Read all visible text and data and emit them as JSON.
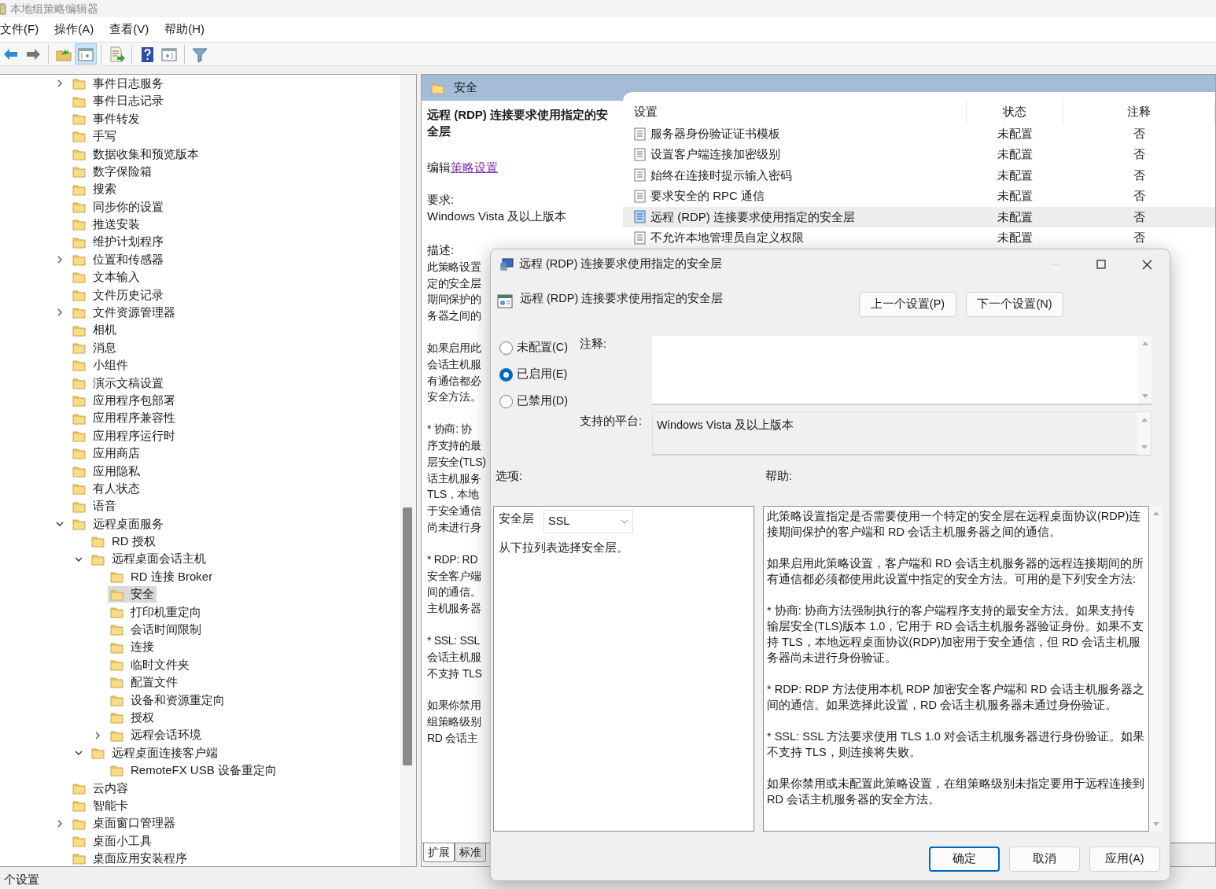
{
  "window": {
    "title": "本地组策略编辑器"
  },
  "menu": [
    {
      "label": "文件(F)"
    },
    {
      "label": "操作(A)"
    },
    {
      "label": "查看(V)"
    },
    {
      "label": "帮助(H)"
    }
  ],
  "toolbar": [
    {
      "kind": "back",
      "selected": false
    },
    {
      "kind": "forward",
      "selected": false
    },
    {
      "kind": "up",
      "selected": false
    },
    {
      "kind": "tree",
      "selected": true
    },
    {
      "kind": "export",
      "selected": false
    },
    {
      "kind": "help",
      "selected": false
    },
    {
      "kind": "pane",
      "selected": false
    },
    {
      "kind": "filter",
      "selected": false
    }
  ],
  "tree": [
    {
      "label": "事件日志服务",
      "expanded": false,
      "selected": false
    },
    {
      "label": "事件日志记录",
      "selected": false
    },
    {
      "label": "事件转发",
      "selected": false
    },
    {
      "label": "手写",
      "selected": false
    },
    {
      "label": "数据收集和预览版本",
      "selected": false
    },
    {
      "label": "数字保险箱",
      "selected": false
    },
    {
      "label": "搜索",
      "selected": false
    },
    {
      "label": "同步你的设置",
      "selected": false
    },
    {
      "label": "推送安装",
      "selected": false
    },
    {
      "label": "维护计划程序",
      "selected": false
    },
    {
      "label": "位置和传感器",
      "expanded": false,
      "selected": false
    },
    {
      "label": "文本输入",
      "selected": false
    },
    {
      "label": "文件历史记录",
      "selected": false
    },
    {
      "label": "文件资源管理器",
      "expanded": false,
      "selected": false
    },
    {
      "label": "相机",
      "selected": false
    },
    {
      "label": "消息",
      "selected": false
    },
    {
      "label": "小组件",
      "selected": false
    },
    {
      "label": "演示文稿设置",
      "selected": false
    },
    {
      "label": "应用程序包部署",
      "selected": false
    },
    {
      "label": "应用程序兼容性",
      "selected": false
    },
    {
      "label": "应用程序运行时",
      "selected": false
    },
    {
      "label": "应用商店",
      "selected": false
    },
    {
      "label": "应用隐私",
      "selected": false
    },
    {
      "label": "有人状态",
      "selected": false
    },
    {
      "label": "语音",
      "selected": false
    },
    {
      "label": "远程桌面服务",
      "expanded": true,
      "selected": false,
      "children": [
        {
          "label": "RD 授权",
          "selected": false
        },
        {
          "label": "远程桌面会话主机",
          "expanded": true,
          "selected": false,
          "children": [
            {
              "label": "RD 连接 Broker",
              "selected": false
            },
            {
              "label": "安全",
              "selected": true
            },
            {
              "label": "打印机重定向",
              "selected": false
            },
            {
              "label": "会话时间限制",
              "selected": false
            },
            {
              "label": "连接",
              "selected": false
            },
            {
              "label": "临时文件夹",
              "selected": false
            },
            {
              "label": "配置文件",
              "selected": false
            },
            {
              "label": "设备和资源重定向",
              "selected": false
            },
            {
              "label": "授权",
              "selected": false
            },
            {
              "label": "远程会话环境",
              "expanded": false,
              "selected": false
            }
          ]
        },
        {
          "label": "远程桌面连接客户端",
          "expanded": true,
          "selected": false,
          "children": [
            {
              "label": "RemoteFX USB 设备重定向",
              "selected": false
            }
          ]
        }
      ]
    },
    {
      "label": "云内容",
      "selected": false
    },
    {
      "label": "智能卡",
      "selected": false
    },
    {
      "label": "桌面窗口管理器",
      "expanded": false,
      "selected": false
    },
    {
      "label": "桌面小工具",
      "selected": false
    },
    {
      "label": "桌面应用安装程序",
      "selected": false
    }
  ],
  "details": {
    "header": "安全",
    "title": "远程 (RDP) 连接要求使用指定的安全层",
    "edit_prefix": "编辑",
    "edit_link": "策略设置",
    "requirements_label": "要求:",
    "requirements": "Windows Vista 及以上版本",
    "description_label": "描述:",
    "description_paragraphs": [
      [
        "此策略设置",
        "定的安全层",
        "期间保护的",
        "务器之间的"
      ],
      [
        "如果启用此",
        "会话主机服",
        "有通信都必",
        "安全方法。"
      ],
      [
        "* 协商: 协",
        "序支持的最",
        "层安全(TLS)",
        "话主机服务",
        "TLS，本地",
        "于安全通信",
        "尚未进行身"
      ],
      [
        "* RDP: RD",
        "安全客户端",
        "间的通信。",
        "主机服务器"
      ],
      [
        "* SSL: SSL",
        "会话主机服",
        "不支持 TLS"
      ],
      [
        "如果你禁用",
        "组策略级别",
        "RD 会话主"
      ]
    ]
  },
  "settings_table": {
    "columns": [
      "设置",
      "状态",
      "注释"
    ],
    "rows": [
      {
        "name": "服务器身份验证证书模板",
        "state": "未配置",
        "comment": "否",
        "selected": false
      },
      {
        "name": "设置客户端连接加密级别",
        "state": "未配置",
        "comment": "否",
        "selected": false
      },
      {
        "name": "始终在连接时提示输入密码",
        "state": "未配置",
        "comment": "否",
        "selected": false
      },
      {
        "name": "要求安全的 RPC 通信",
        "state": "未配置",
        "comment": "否",
        "selected": false
      },
      {
        "name": "远程 (RDP) 连接要求使用指定的安全层",
        "state": "未配置",
        "comment": "否",
        "selected": true
      },
      {
        "name": "不允许本地管理员自定义权限",
        "state": "未配置",
        "comment": "否",
        "selected": false
      }
    ]
  },
  "view_tabs": [
    {
      "label": "扩展",
      "selected": true
    },
    {
      "label": "标准",
      "selected": false
    }
  ],
  "status_bar": "个设置",
  "dialog": {
    "title": "远程 (RDP) 连接要求使用指定的安全层",
    "policy_title": "远程 (RDP) 连接要求使用指定的安全层",
    "prev_button": "上一个设置(P)",
    "next_button": "下一个设置(N)",
    "states": [
      {
        "label": "未配置(C)",
        "selected": false
      },
      {
        "label": "已启用(E)",
        "selected": true
      },
      {
        "label": "已禁用(D)",
        "selected": false
      }
    ],
    "comment_label": "注释:",
    "platform_label": "支持的平台:",
    "platform": "Windows Vista 及以上版本",
    "options_label": "选项:",
    "help_label": "帮助:",
    "option": {
      "label": "安全层",
      "value": "SSL",
      "hint": "从下拉列表选择安全层。"
    },
    "help": [
      "此策略设置指定是否需要使用一个特定的安全层在远程桌面协议(RDP)连接期间保护的客户端和 RD 会话主机服务器之间的通信。",
      "如果启用此策略设置，客户端和 RD 会话主机服务器的远程连接期间的所有通信都必须都使用此设置中指定的安全方法。可用的是下列安全方法:",
      "* 协商: 协商方法强制执行的客户端程序支持的最安全方法。如果支持传输层安全(TLS)版本 1.0，它用于 RD 会话主机服务器验证身份。如果不支持 TLS，本地远程桌面协议(RDP)加密用于安全通信，但 RD 会话主机服务器尚未进行身份验证。",
      "* RDP: RDP 方法使用本机 RDP 加密安全客户端和 RD 会话主机服务器之间的通信。如果选择此设置，RD 会话主机服务器未通过身份验证。",
      "* SSL: SSL 方法要求使用 TLS 1.0 对会话主机服务器进行身份验证。如果不支持 TLS，则连接将失败。",
      "如果你禁用或未配置此策略设置，在组策略级别未指定要用于远程连接到 RD 会话主机服务器的安全方法。"
    ],
    "buttons": [
      {
        "label": "确定",
        "default": true
      },
      {
        "label": "取消",
        "default": false
      },
      {
        "label": "应用(A)",
        "default": false
      }
    ]
  }
}
